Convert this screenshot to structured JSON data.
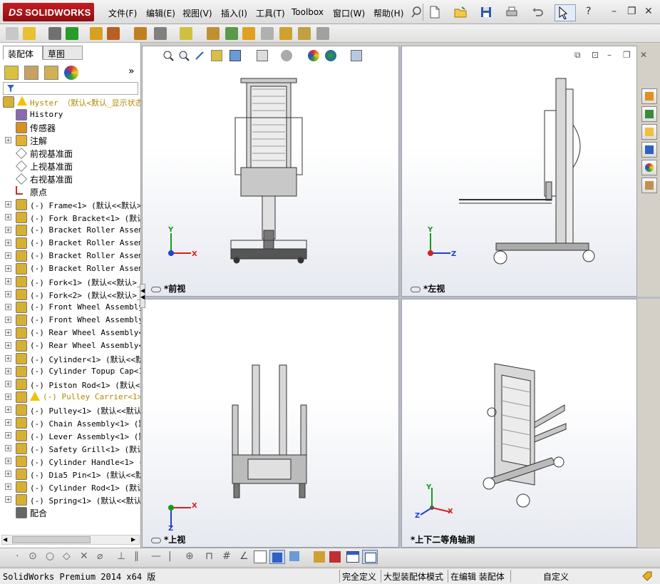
{
  "app": {
    "logo_prefix": "DS",
    "logo_name": "SOLIDWORKS",
    "menu": [
      "文件(F)",
      "编辑(E)",
      "视图(V)",
      "插入(I)",
      "工具(T)",
      "Toolbox",
      "窗口(W)",
      "帮助(H)"
    ],
    "window_controls": [
      "–",
      "❐",
      "✕"
    ],
    "help_glyph": "?"
  },
  "panel": {
    "tabs": [
      "装配体",
      "草图"
    ],
    "expand_glyph": "»",
    "tree": [
      {
        "label": "Hyster  （默认<默认_显示状态",
        "kind": "root",
        "warn": true
      },
      {
        "label": "History",
        "kind": "history"
      },
      {
        "label": "传感器",
        "kind": "sensor"
      },
      {
        "label": "注解",
        "kind": "annot",
        "expandable": true
      },
      {
        "label": "前视基准面",
        "kind": "plane"
      },
      {
        "label": "上视基准面",
        "kind": "plane"
      },
      {
        "label": "右视基准面",
        "kind": "plane"
      },
      {
        "label": "原点",
        "kind": "origin"
      },
      {
        "label": "(-) Frame<1> (默认<<默认>_",
        "kind": "part",
        "expandable": true
      },
      {
        "label": "(-) Fork Bracket<1> (默认<",
        "kind": "part",
        "expandable": true
      },
      {
        "label": "(-) Bracket Roller Assembl",
        "kind": "part",
        "expandable": true
      },
      {
        "label": "(-) Bracket Roller Assembl",
        "kind": "part",
        "expandable": true
      },
      {
        "label": "(-) Bracket Roller Assembl",
        "kind": "part",
        "expandable": true
      },
      {
        "label": "(-) Bracket Roller Assembl",
        "kind": "part",
        "expandable": true
      },
      {
        "label": "(-) Fork<1> (默认<<默认>_",
        "kind": "part",
        "expandable": true
      },
      {
        "label": "(-) Fork<2> (默认<<默认>_",
        "kind": "part",
        "expandable": true
      },
      {
        "label": "(-) Front Wheel Assembly<",
        "kind": "part",
        "expandable": true
      },
      {
        "label": "(-) Front Wheel Assembly<",
        "kind": "part",
        "expandable": true
      },
      {
        "label": "(-) Rear Wheel Assembly<1",
        "kind": "part",
        "expandable": true
      },
      {
        "label": "(-) Rear Wheel Assembly<2",
        "kind": "part",
        "expandable": true
      },
      {
        "label": "(-) Cylinder<1> (默认<<默",
        "kind": "part",
        "expandable": true
      },
      {
        "label": "(-) Cylinder Topup Cap<1>",
        "kind": "part",
        "expandable": true
      },
      {
        "label": "(-) Piston Rod<1> (默认<<",
        "kind": "part",
        "expandable": true
      },
      {
        "label": "(-) Pulley Carrier<1>",
        "kind": "part",
        "expandable": true,
        "warn": true
      },
      {
        "label": "(-) Pulley<1> (默认<<默认>",
        "kind": "part",
        "expandable": true
      },
      {
        "label": "(-) Chain Assembly<1> (默",
        "kind": "part",
        "expandable": true
      },
      {
        "label": "(-) Lever Assembly<1> (默",
        "kind": "part",
        "expandable": true
      },
      {
        "label": "(-) Safety Grill<1> (默认<",
        "kind": "part",
        "expandable": true
      },
      {
        "label": "(-) Cylinder Handle<1> (默",
        "kind": "part",
        "expandable": true
      },
      {
        "label": "(-) Dia5 Pin<1> (默认<<默",
        "kind": "part",
        "expandable": true
      },
      {
        "label": "(-) Cylinder Rod<1> (默认<",
        "kind": "part",
        "expandable": true
      },
      {
        "label": "(-) Spring<1> (默认<<默认>",
        "kind": "part",
        "expandable": true
      },
      {
        "label": "配合",
        "kind": "mates"
      }
    ]
  },
  "viewports": {
    "front": {
      "label": "*前视"
    },
    "left": {
      "label": "*左视"
    },
    "top": {
      "label": "*上视"
    },
    "iso": {
      "label": "*上下二等角轴测"
    }
  },
  "axes": {
    "x": "X",
    "y": "Y",
    "z": "Z"
  },
  "status": {
    "app_version": "SolidWorks Premium 2014 x64 版",
    "constraint": "完全定义",
    "mode": "大型装配体模式",
    "editing": "在编辑 装配体",
    "custom": "自定义"
  },
  "colors": {
    "logo_red": "#c51c22",
    "warn_yellow": "#f2c200",
    "axis_x": "#d62020",
    "axis_y": "#1a9a1a",
    "axis_z": "#2040d0"
  }
}
